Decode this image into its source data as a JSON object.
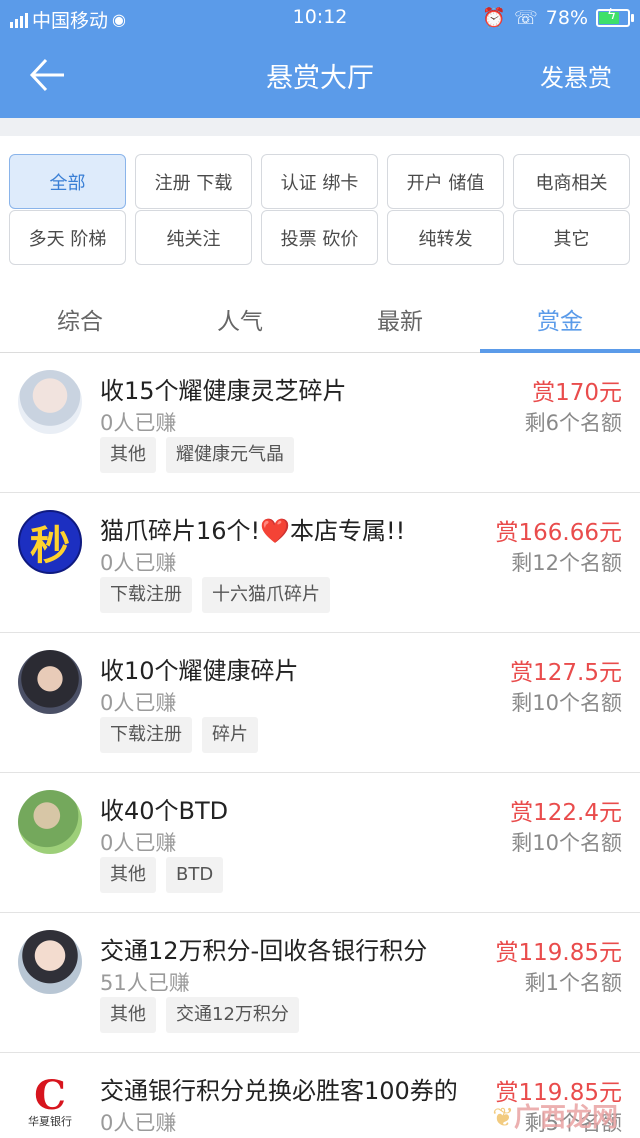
{
  "status": {
    "carrier": "中国移动",
    "time": "10:12",
    "battery": "78%",
    "battery_level": 0.78,
    "signal_icon": "signal-icon",
    "wifi_icon": "wifi-icon",
    "alarm_icon": "alarm-icon",
    "hd_call_icon": "hd-call-icon"
  },
  "header": {
    "title": "悬赏大厅",
    "action": "发悬赏",
    "back_icon": "back-arrow-icon"
  },
  "categories": [
    {
      "label": "全部",
      "active": true
    },
    {
      "label": "注册 下载",
      "active": false
    },
    {
      "label": "认证 绑卡",
      "active": false
    },
    {
      "label": "开户 储值",
      "active": false
    },
    {
      "label": "电商相关",
      "active": false
    },
    {
      "label": "多天 阶梯",
      "active": false
    },
    {
      "label": "纯关注",
      "active": false
    },
    {
      "label": "投票 砍价",
      "active": false
    },
    {
      "label": "纯转发",
      "active": false
    },
    {
      "label": "其它",
      "active": false
    }
  ],
  "tabs": [
    {
      "label": "综合",
      "active": false
    },
    {
      "label": "人气",
      "active": false
    },
    {
      "label": "最新",
      "active": false
    },
    {
      "label": "赏金",
      "active": true
    }
  ],
  "items": [
    {
      "title": "收15个耀健康灵芝碎片",
      "earned": "0人已赚",
      "tags": [
        "其他",
        "耀健康元气晶"
      ],
      "reward": "赏170元",
      "quota": "剩6个名额"
    },
    {
      "title": "猫爪碎片16个!❤️本店专属!!",
      "earned": "0人已赚",
      "tags": [
        "下载注册",
        "十六猫爪碎片"
      ],
      "reward": "赏166.66元",
      "quota": "剩12个名额",
      "avatar_text": "秒"
    },
    {
      "title": "收10个耀健康碎片",
      "earned": "0人已赚",
      "tags": [
        "下载注册",
        "碎片"
      ],
      "reward": "赏127.5元",
      "quota": "剩10个名额"
    },
    {
      "title": "收40个BTD",
      "earned": "0人已赚",
      "tags": [
        "其他",
        "BTD"
      ],
      "reward": "赏122.4元",
      "quota": "剩10个名额"
    },
    {
      "title": "交通12万积分-回收各银行积分",
      "earned": "51人已赚",
      "tags": [
        "其他",
        "交通12万积分"
      ],
      "reward": "赏119.85元",
      "quota": "剩1个名额"
    },
    {
      "title": "交通银行积分兑换必胜客100券的",
      "earned": "0人已赚",
      "tags": [],
      "reward": "赏119.85元",
      "quota": "剩5个名额",
      "avatar_text": "华夏银行"
    }
  ],
  "watermark": "广西龙网"
}
